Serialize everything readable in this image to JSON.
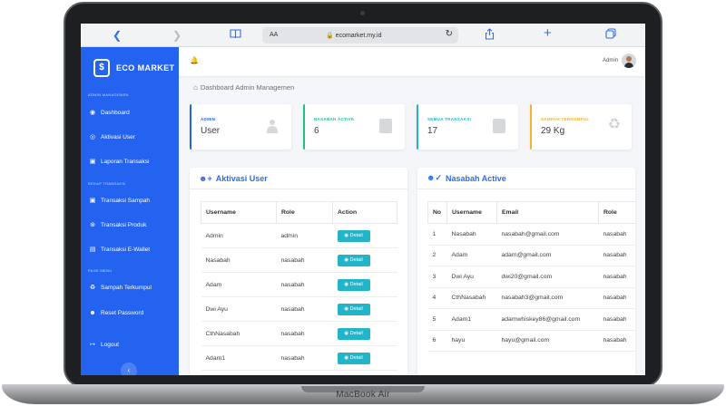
{
  "device": {
    "label": "MacBook Air"
  },
  "browser": {
    "aa_label": "AA",
    "url": "ecomarket.my.id"
  },
  "sidebar": {
    "logo_text": "ECO MARKET",
    "logo_glyph": "$",
    "sections": [
      {
        "title": "Admin Managemen"
      },
      {
        "title": "Rekap Transaksi"
      },
      {
        "title": "Page Menu"
      }
    ],
    "items": [
      {
        "label": "Dashboard",
        "icon": "dashboard-icon"
      },
      {
        "label": "Aktivasi User",
        "icon": "eye-icon"
      },
      {
        "label": "Laporan Transaksi",
        "icon": "document-icon"
      },
      {
        "label": "Transaksi Sampah",
        "icon": "document-icon"
      },
      {
        "label": "Transaksi Produk",
        "icon": "cart-icon"
      },
      {
        "label": "Transaksi E-Wallet",
        "icon": "wallet-icon"
      },
      {
        "label": "Sampah Terkumpul",
        "icon": "recycle-icon"
      },
      {
        "label": "Reset Password",
        "icon": "user-icon"
      },
      {
        "label": "Logout",
        "icon": "logout-icon"
      }
    ]
  },
  "topbar": {
    "user_name": "Admin"
  },
  "breadcrumb": "Dashboard Admin Managemen",
  "stats": [
    {
      "label": "ADMIN",
      "value": "User",
      "color": "#2463f0",
      "icon": "person-icon"
    },
    {
      "label": "NASABAH ACTIVE",
      "value": "6",
      "color": "#1fbf86",
      "icon": "card-icon"
    },
    {
      "label": "SEMUA TRANSAKSI",
      "value": "17",
      "color": "#22b5c9",
      "icon": "card-icon"
    },
    {
      "label": "SAMPAH TERKUMPUL",
      "value": "29 Kg",
      "color": "#f3b32a",
      "icon": "recycle-icon"
    }
  ],
  "aktivasi": {
    "title": "Aktivasi User",
    "columns": [
      "Username",
      "Role",
      "Action"
    ],
    "button_label": "Detail",
    "rows": [
      {
        "username": "Admin",
        "role": "admin"
      },
      {
        "username": "Nasabah",
        "role": "nasabah"
      },
      {
        "username": "Adam",
        "role": "nasabah"
      },
      {
        "username": "Dwi Ayu",
        "role": "nasabah"
      },
      {
        "username": "CthNasabah",
        "role": "nasabah"
      },
      {
        "username": "Adam1",
        "role": "nasabah"
      }
    ]
  },
  "nasabah": {
    "title": "Nasabah Active",
    "columns": [
      "No",
      "Username",
      "Email",
      "Role"
    ],
    "rows": [
      {
        "no": "1",
        "username": "Nasabah",
        "email": "nasabah@gmail.com",
        "role": "nasabah"
      },
      {
        "no": "2",
        "username": "Adam",
        "email": "adam@gmail.com",
        "role": "nasabah"
      },
      {
        "no": "3",
        "username": "Dwi Ayu",
        "email": "dwi20@gmail.com",
        "role": "nasabah"
      },
      {
        "no": "4",
        "username": "CthNasabah",
        "email": "nasabah3@gmail.com",
        "role": "nasabah"
      },
      {
        "no": "5",
        "username": "Adam1",
        "email": "adamwhiskey86@gmail.com",
        "role": "nasabah"
      },
      {
        "no": "6",
        "username": "hayu",
        "email": "hayu@gmail.com",
        "role": "nasabah"
      }
    ]
  }
}
